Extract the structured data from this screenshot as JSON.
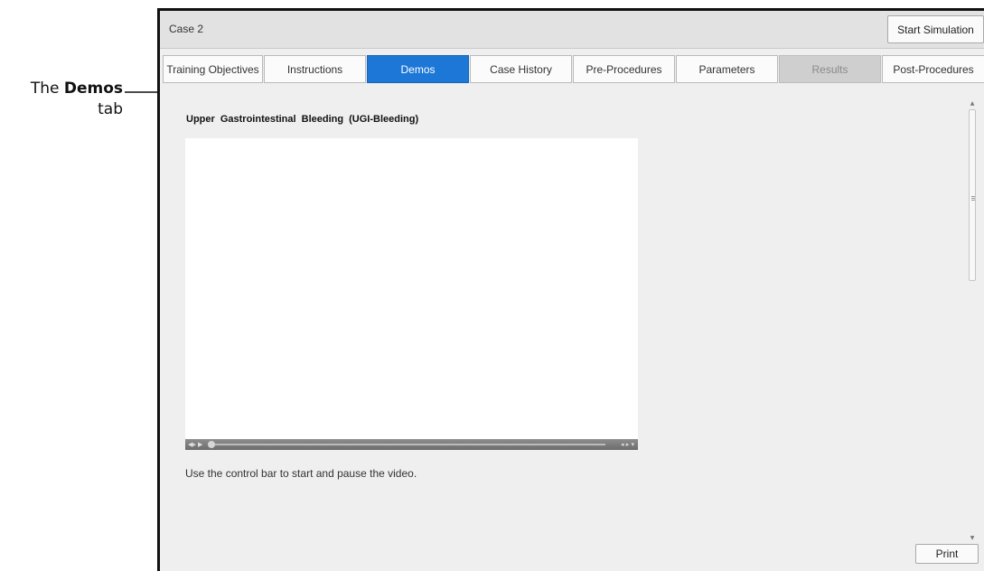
{
  "annotation": {
    "prefix": "The ",
    "bold": "Demos",
    "suffix": "tab"
  },
  "header": {
    "case_title": "Case 2",
    "start_label": "Start Simulation"
  },
  "tabs": [
    {
      "label": "Training Objectives",
      "state": "normal"
    },
    {
      "label": "Instructions",
      "state": "normal"
    },
    {
      "label": "Demos",
      "state": "active"
    },
    {
      "label": "Case History",
      "state": "normal"
    },
    {
      "label": "Pre-Procedures",
      "state": "normal"
    },
    {
      "label": "Parameters",
      "state": "normal"
    },
    {
      "label": "Results",
      "state": "disabled"
    },
    {
      "label": "Post-Procedures",
      "state": "normal"
    }
  ],
  "content": {
    "title": "Upper Gastrointestinal Bleeding (UGI-Bleeding)",
    "hint": "Use the control bar to start and pause the video."
  },
  "footer": {
    "print_label": "Print"
  },
  "colors": {
    "active_tab": "#1c77d6",
    "disabled_tab": "#cfcfcf",
    "panel": "#efefef"
  },
  "icons": [
    "volume-icon",
    "play-icon",
    "seek-knob-icon",
    "fullscreen-icon",
    "scroll-up-icon",
    "scroll-down-icon"
  ]
}
